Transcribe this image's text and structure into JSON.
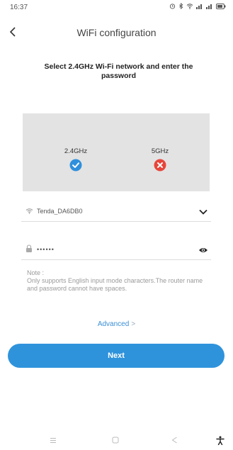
{
  "status_bar": {
    "time": "16:37",
    "icons": [
      "alarm-icon",
      "bluetooth-icon",
      "wifi-icon",
      "signal-icon",
      "signal-icon",
      "battery-icon"
    ]
  },
  "header": {
    "title": "WiFi configuration",
    "back_icon": "back-arrow-icon"
  },
  "instruction": "Select 2.4GHz Wi-Fi network and enter the password",
  "bands": [
    {
      "label": "2.4GHz",
      "status": "supported",
      "color": "#2f8fdc"
    },
    {
      "label": "5GHz",
      "status": "unsupported",
      "color": "#e8453c"
    }
  ],
  "ssid_field": {
    "value": "Tenda_DA6DB0",
    "icon": "wifi-icon",
    "action_icon": "chevron-down-icon"
  },
  "password_field": {
    "value": "••••••",
    "icon": "lock-icon",
    "action_icon": "eye-icon"
  },
  "note": {
    "title": "Note :",
    "body": "Only supports English input mode characters.The router name and password cannot have spaces."
  },
  "advanced_link": "Advanced",
  "next_button": "Next",
  "colors": {
    "accent": "#2f93dc",
    "error": "#e8453c",
    "panel": "#e3e3e3"
  },
  "nav_bar": [
    "menu-icon",
    "home-icon",
    "back-icon",
    "accessibility-icon"
  ]
}
